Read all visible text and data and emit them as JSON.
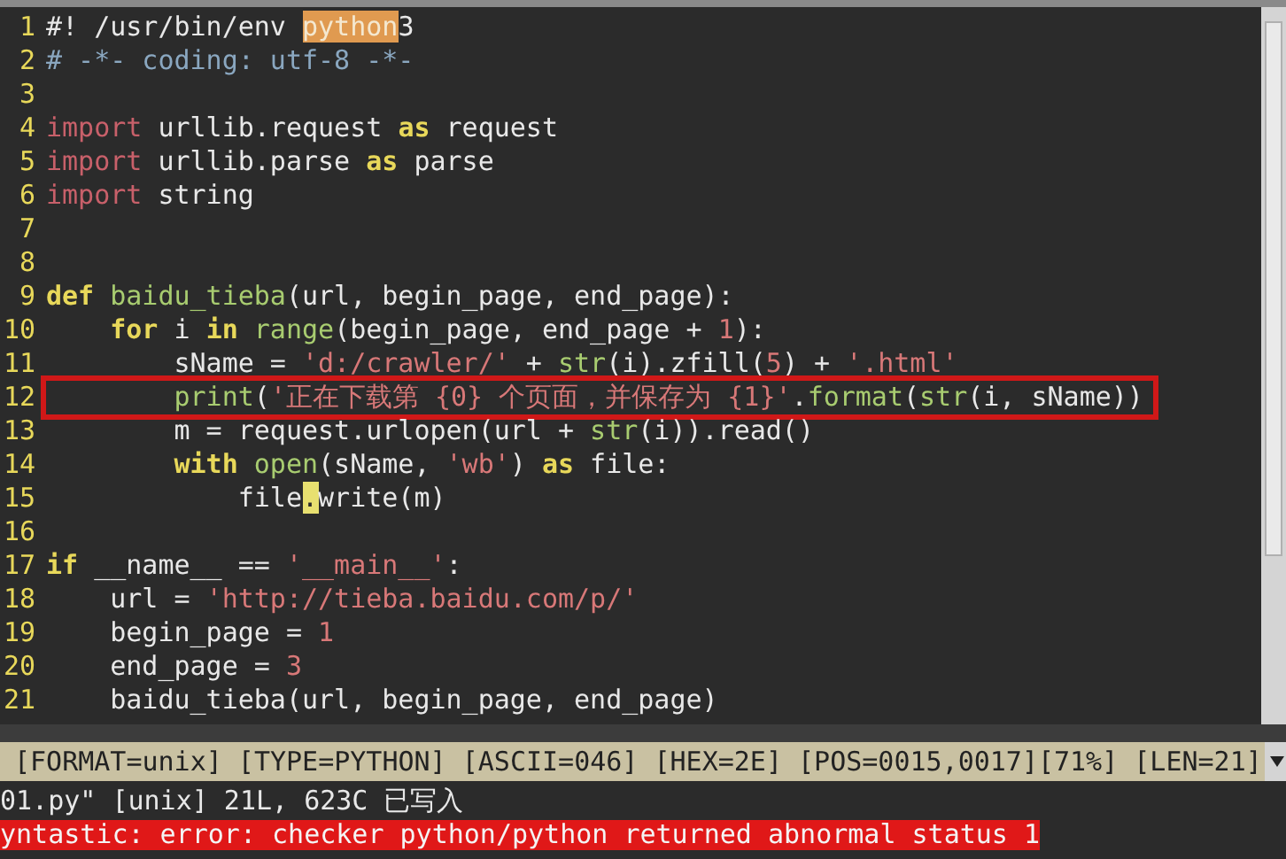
{
  "editor": {
    "lines": [
      {
        "number": "1",
        "boxed": false,
        "tokens": [
          {
            "text": "#! /usr/bin/env ",
            "kind": "plain"
          },
          {
            "text": "python",
            "kind": "search"
          },
          {
            "text": "3",
            "kind": "plain"
          }
        ]
      },
      {
        "number": "2",
        "boxed": false,
        "tokens": [
          {
            "text": "# -*- coding: utf-8 -*-",
            "kind": "comment"
          }
        ]
      },
      {
        "number": "3",
        "boxed": false
      },
      {
        "number": "4",
        "boxed": false,
        "tokens": [
          {
            "text": "import",
            "kind": "import"
          },
          {
            "text": " urllib.request ",
            "kind": "plain"
          },
          {
            "text": "as",
            "kind": "keyword"
          },
          {
            "text": " request",
            "kind": "plain"
          }
        ]
      },
      {
        "number": "5",
        "boxed": false,
        "tokens": [
          {
            "text": "import",
            "kind": "import"
          },
          {
            "text": " urllib.parse ",
            "kind": "plain"
          },
          {
            "text": "as",
            "kind": "keyword"
          },
          {
            "text": " parse",
            "kind": "plain"
          }
        ]
      },
      {
        "number": "6",
        "boxed": false,
        "tokens": [
          {
            "text": "import",
            "kind": "import"
          },
          {
            "text": " string",
            "kind": "plain"
          }
        ]
      },
      {
        "number": "7",
        "boxed": false
      },
      {
        "number": "8",
        "boxed": false
      },
      {
        "number": "9",
        "boxed": false,
        "tokens": [
          {
            "text": "def",
            "kind": "keyword"
          },
          {
            "text": " baidu_tieba",
            "kind": "func"
          },
          {
            "text": "(url, begin_page, end_page):",
            "kind": "plain"
          }
        ]
      },
      {
        "number": "10",
        "boxed": false,
        "tokens": [
          {
            "text": "    for",
            "kind": "keyword"
          },
          {
            "text": " i ",
            "kind": "plain"
          },
          {
            "text": "in",
            "kind": "keyword"
          },
          {
            "text": " range",
            "kind": "func"
          },
          {
            "text": "(begin_page, end_page + ",
            "kind": "plain"
          },
          {
            "text": "1",
            "kind": "number"
          },
          {
            "text": "):",
            "kind": "plain"
          }
        ]
      },
      {
        "number": "11",
        "boxed": false,
        "tokens": [
          {
            "text": "        sName = ",
            "kind": "plain"
          },
          {
            "text": "'d:/crawler/'",
            "kind": "string"
          },
          {
            "text": " + ",
            "kind": "plain"
          },
          {
            "text": "str",
            "kind": "func"
          },
          {
            "text": "(i).zfill(",
            "kind": "plain"
          },
          {
            "text": "5",
            "kind": "number"
          },
          {
            "text": ") + ",
            "kind": "plain"
          },
          {
            "text": "'.html'",
            "kind": "string"
          }
        ]
      },
      {
        "number": "12",
        "boxed": true,
        "tokens": [
          {
            "text": "        print",
            "kind": "func"
          },
          {
            "text": "(",
            "kind": "plain"
          },
          {
            "text": "'正在下载第 {0} 个页面，并保存为 {1}'",
            "kind": "string"
          },
          {
            "text": ".",
            "kind": "plain"
          },
          {
            "text": "format",
            "kind": "func"
          },
          {
            "text": "(",
            "kind": "plain"
          },
          {
            "text": "str",
            "kind": "func"
          },
          {
            "text": "(i, sName))",
            "kind": "plain"
          }
        ]
      },
      {
        "number": "13",
        "boxed": false,
        "tokens": [
          {
            "text": "        m = request.urlopen(url + ",
            "kind": "plain"
          },
          {
            "text": "str",
            "kind": "func"
          },
          {
            "text": "(i)).read()",
            "kind": "plain"
          }
        ]
      },
      {
        "number": "14",
        "boxed": false,
        "tokens": [
          {
            "text": "        with",
            "kind": "keyword"
          },
          {
            "text": " open",
            "kind": "func"
          },
          {
            "text": "(sName, ",
            "kind": "plain"
          },
          {
            "text": "'wb'",
            "kind": "string"
          },
          {
            "text": ") ",
            "kind": "plain"
          },
          {
            "text": "as",
            "kind": "keyword"
          },
          {
            "text": " file:",
            "kind": "plain"
          }
        ]
      },
      {
        "number": "15",
        "boxed": false,
        "tokens": [
          {
            "text": "            file",
            "kind": "plain"
          },
          {
            "text": ".",
            "kind": "cursor"
          },
          {
            "text": "write(m)",
            "kind": "plain"
          }
        ]
      },
      {
        "number": "16",
        "boxed": false
      },
      {
        "number": "17",
        "boxed": false,
        "tokens": [
          {
            "text": "if",
            "kind": "keyword"
          },
          {
            "text": " __name__ == ",
            "kind": "plain"
          },
          {
            "text": "'__main__'",
            "kind": "string"
          },
          {
            "text": ":",
            "kind": "plain"
          }
        ]
      },
      {
        "number": "18",
        "boxed": false,
        "tokens": [
          {
            "text": "    url = ",
            "kind": "plain"
          },
          {
            "text": "'http://tieba.baidu.com/p/'",
            "kind": "string"
          }
        ]
      },
      {
        "number": "19",
        "boxed": false,
        "tokens": [
          {
            "text": "    begin_page = ",
            "kind": "plain"
          },
          {
            "text": "1",
            "kind": "number"
          }
        ]
      },
      {
        "number": "20",
        "boxed": false,
        "tokens": [
          {
            "text": "    end_page = ",
            "kind": "plain"
          },
          {
            "text": "3",
            "kind": "number"
          }
        ]
      },
      {
        "number": "21",
        "boxed": false,
        "tokens": [
          {
            "text": "    baidu_tieba(url, begin_page, end_page)",
            "kind": "plain"
          }
        ]
      }
    ]
  },
  "status_line": "[FORMAT=unix] [TYPE=PYTHON] [ASCII=046] [HEX=2E] [POS=0015,0017][71%] [LEN=21]",
  "message": "01.py\" [unix] 21L, 623C 已写入",
  "error": "yntastic: error: checker python/python returned abnormal status 1"
}
